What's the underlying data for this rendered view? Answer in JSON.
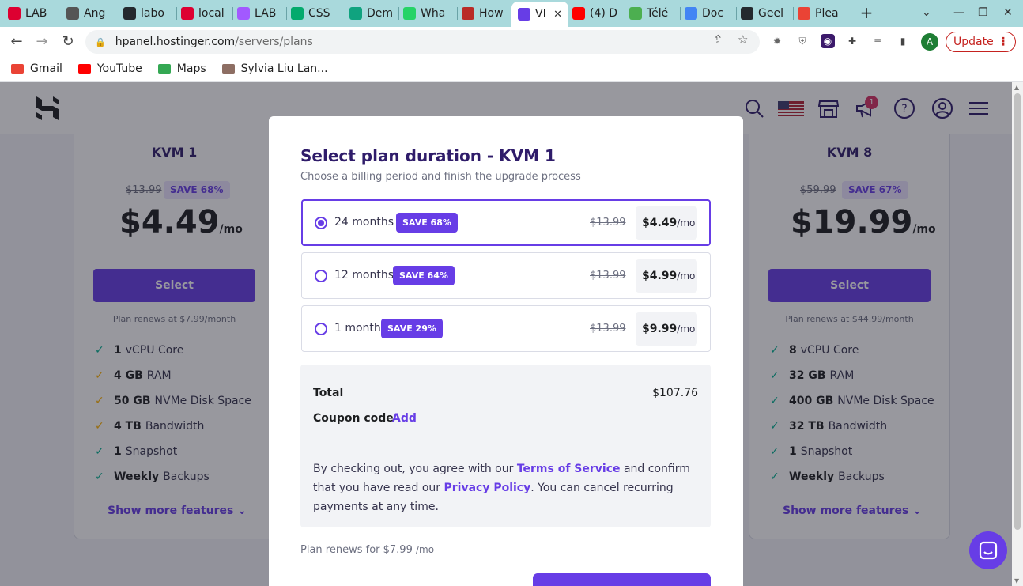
{
  "browser": {
    "tabs": [
      {
        "label": "LAB",
        "icon": "angular-icon",
        "color": "#dd0031"
      },
      {
        "label": "Ang",
        "icon": "browser-icon",
        "color": "#555555"
      },
      {
        "label": "labo",
        "icon": "github-icon",
        "color": "#24292e"
      },
      {
        "label": "local",
        "icon": "angular-icon",
        "color": "#dd0031"
      },
      {
        "label": "LAB",
        "icon": "figma-icon",
        "color": "#a259ff"
      },
      {
        "label": "CSS",
        "icon": "w3schools-icon",
        "color": "#04aa6d"
      },
      {
        "label": "Dem",
        "icon": "chatgpt-icon",
        "color": "#10a37f"
      },
      {
        "label": "Wha",
        "icon": "whatsapp-icon",
        "color": "#25d366"
      },
      {
        "label": "How",
        "icon": "quora-icon",
        "color": "#b92b27"
      },
      {
        "label": "VI",
        "icon": "hostinger-icon",
        "color": "#673de6",
        "active": true
      },
      {
        "label": "(4) D",
        "icon": "youtube-icon",
        "color": "#ff0000"
      },
      {
        "label": "Télé",
        "icon": "download-icon",
        "color": "#4caf50"
      },
      {
        "label": "Doc",
        "icon": "docs-icon",
        "color": "#4285f4"
      },
      {
        "label": "Geel",
        "icon": "github-icon",
        "color": "#24292e"
      },
      {
        "label": "Plea",
        "icon": "gmail-icon",
        "color": "#ea4335"
      }
    ],
    "url_host": "hpanel.hostinger.com",
    "url_path": "/servers/plans",
    "profile_initial": "A",
    "update_label": "Update",
    "bookmarks": [
      {
        "label": "Gmail",
        "color": "#ea4335"
      },
      {
        "label": "YouTube",
        "color": "#ff0000"
      },
      {
        "label": "Maps",
        "color": "#34a853"
      },
      {
        "label": "Sylvia Liu Lan...",
        "color": "#8d6e63"
      }
    ]
  },
  "header": {
    "notification_count": "1"
  },
  "plans": [
    {
      "name": "KVM 1",
      "old_price": "$13.99",
      "save": "SAVE 68%",
      "price": "$4.49",
      "per": "/mo",
      "select_label": "Select",
      "renew": "Plan renews at $7.99/month",
      "features": [
        {
          "bold": "1",
          "text": "vCPU Core"
        },
        {
          "bold": "4 GB",
          "text": "RAM"
        },
        {
          "bold": "50 GB",
          "text": "NVMe Disk Space"
        },
        {
          "bold": "4 TB",
          "text": "Bandwidth"
        },
        {
          "bold": "1",
          "text": "Snapshot"
        },
        {
          "bold": "Weekly",
          "text": "Backups"
        }
      ],
      "show_more": "Show more features"
    },
    {
      "name": "KVM 8",
      "old_price": "$59.99",
      "save": "SAVE 67%",
      "price": "$19.99",
      "per": "/mo",
      "select_label": "Select",
      "renew": "Plan renews at $44.99/month",
      "features": [
        {
          "bold": "8",
          "text": "vCPU Core"
        },
        {
          "bold": "32 GB",
          "text": "RAM"
        },
        {
          "bold": "400 GB",
          "text": "NVMe Disk Space"
        },
        {
          "bold": "32 TB",
          "text": "Bandwidth"
        },
        {
          "bold": "1",
          "text": "Snapshot"
        },
        {
          "bold": "Weekly",
          "text": "Backups"
        }
      ],
      "show_more": "Show more features"
    }
  ],
  "modal": {
    "title": "Select plan duration - KVM 1",
    "subtitle": "Choose a billing period and finish the upgrade process",
    "periods": [
      {
        "label": "24 months",
        "save": "SAVE 68%",
        "old_price": "$13.99",
        "price": "$4.49",
        "unit": "/mo",
        "selected": true
      },
      {
        "label": "12 months",
        "save": "SAVE 64%",
        "old_price": "$13.99",
        "price": "$4.99",
        "unit": "/mo",
        "selected": false
      },
      {
        "label": "1 month",
        "save": "SAVE 29%",
        "old_price": "$13.99",
        "price": "$9.99",
        "unit": "/mo",
        "selected": false
      }
    ],
    "total_label": "Total",
    "total_value": "$107.76",
    "coupon_label": "Coupon code",
    "coupon_action": "Add",
    "terms": {
      "pre": "By checking out, you agree with our ",
      "tos": "Terms of Service",
      "mid": " and confirm that you have read our ",
      "privacy": "Privacy Policy",
      "post": ". You can cancel recurring payments at any time."
    },
    "renew_prefix": "Plan renews for $7.99",
    "renew_unit": "/mo"
  },
  "colors": {
    "brand": "#673de6",
    "brand_dark": "#2f1c6a",
    "overlay": "rgba(26,27,40,0.45)"
  }
}
